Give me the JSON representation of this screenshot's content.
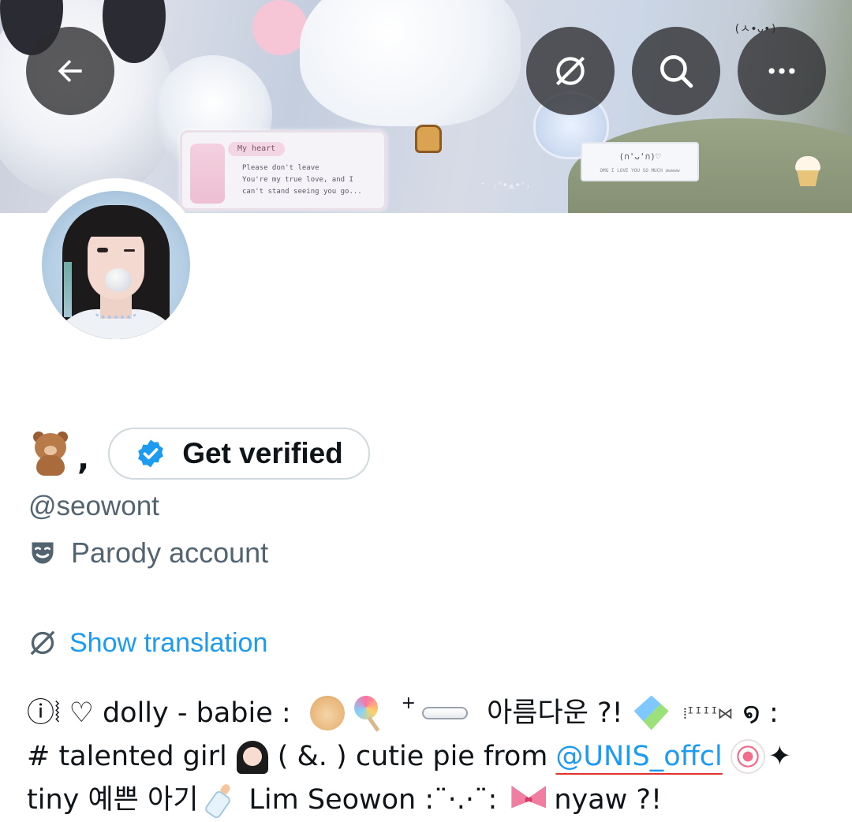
{
  "header": {
    "back_icon": "arrow-left-icon",
    "translate_icon": "no-translate-icon",
    "search_icon": "search-icon",
    "more_icon": "more-horizontal-icon"
  },
  "banner": {
    "card1_title": "My heart",
    "card1_line1": "Please don't leave",
    "card1_line2": "You're my true love, and I",
    "card1_line3": "can't stand seeing you go...",
    "card2_title": "(ก'ᴗ'ก)♡",
    "card2_sub": "OMG I LOVE YOU SO MUCH awwww",
    "kaomoji": "(ㅅ•ᴗ•)",
    "watermark": "⁺ ₍ᐢ•ﻌ•ᐢ₎"
  },
  "profile": {
    "name_emoji": "teddy-bear-emoji",
    "name_suffix": ",",
    "verify_label": "Get verified",
    "verify_icon": "verified-badge-icon",
    "handle": "@seowont",
    "parody_icon": "theater-mask-icon",
    "parody_label": "Parody account",
    "translate_label": "Show translation",
    "translate_icon": "no-translate-icon"
  },
  "bio": {
    "line1_a": "ⓘ⦚  ♡ dolly - babie :",
    "line1_plus": "+",
    "line1_b": "아름다운 ?!",
    "line1_bars": "⁞ᴵᴵᴵᴵ⋈",
    "line1_c": "໑ :",
    "line2_a": "# talented girl",
    "line2_b": "( &. )  cutie pie from",
    "line2_mention": "@UNIS_offcl",
    "line2_c": "✦",
    "line3_a": "tiny  예쁜 아기",
    "line3_b": "Lim Seowon  :¨·.·¨:",
    "line3_c": "nyaw ?!"
  },
  "colors": {
    "accent": "#1d9bf0",
    "muted": "#536471",
    "text": "#0f1419",
    "overlay": "#2c2c2e",
    "border": "#cfd9de"
  }
}
